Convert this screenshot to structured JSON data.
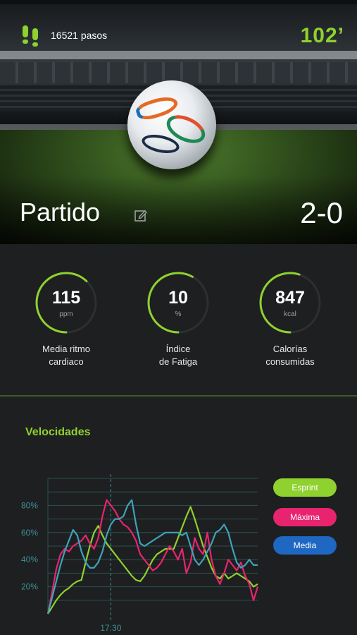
{
  "header": {
    "steps_text": "16521 pasos",
    "minute": "102’",
    "match_title": "Partido",
    "score": "2-0"
  },
  "stats": [
    {
      "value": "115",
      "unit": "ppm",
      "label_line1": "Media ritmo",
      "label_line2": "cardiaco",
      "progress": 0.62
    },
    {
      "value": "10",
      "unit": "%",
      "label_line1": "Índice",
      "label_line2": "de Fatiga",
      "progress": 0.58
    },
    {
      "value": "847",
      "unit": "kcal",
      "label_line1": "Calorías",
      "label_line2": "consumidas",
      "progress": 0.55
    }
  ],
  "colors": {
    "accent": "#8fd12e",
    "esprint": "#8fd12e",
    "maxima": "#e8246e",
    "media": "#1e67c2",
    "background": "#1e1f21"
  },
  "chart_data": {
    "type": "line",
    "title": "Velocidades",
    "xlabel": "",
    "ylabel": "",
    "x_tick_labels": [
      "17:30"
    ],
    "y_tick_labels": [
      "80%",
      "60%",
      "40%",
      "20%"
    ],
    "ylim": [
      0,
      100
    ],
    "x": [
      0,
      1,
      2,
      3,
      4,
      5,
      6,
      7,
      8,
      9,
      10,
      11,
      12,
      13,
      14,
      15,
      16,
      17,
      18,
      19,
      20,
      21,
      22,
      23,
      24,
      25,
      26,
      27,
      28,
      29,
      30,
      31,
      32,
      33,
      34,
      35,
      36,
      37,
      38,
      39,
      40,
      41,
      42,
      43,
      44,
      45,
      46,
      47,
      48,
      49,
      50
    ],
    "series": [
      {
        "name": "Esprint",
        "values": [
          0,
          5,
          10,
          14,
          17,
          19,
          22,
          24,
          25,
          38,
          50,
          60,
          65,
          58,
          52,
          48,
          44,
          40,
          36,
          32,
          28,
          25,
          24,
          28,
          34,
          40,
          44,
          46,
          48,
          48,
          48,
          56,
          64,
          72,
          79,
          70,
          60,
          50,
          42,
          34,
          28,
          26,
          30,
          26,
          28,
          30,
          28,
          26,
          24,
          20,
          22
        ]
      },
      {
        "name": "Máxima",
        "values": [
          0,
          16,
          33,
          44,
          48,
          46,
          50,
          52,
          54,
          58,
          52,
          48,
          56,
          72,
          84,
          80,
          76,
          70,
          66,
          64,
          60,
          54,
          44,
          40,
          36,
          32,
          34,
          38,
          44,
          50,
          46,
          40,
          48,
          30,
          38,
          56,
          48,
          44,
          60,
          40,
          28,
          22,
          30,
          40,
          36,
          32,
          38,
          28,
          22,
          10,
          20
        ]
      },
      {
        "name": "Media",
        "values": [
          0,
          12,
          24,
          36,
          46,
          54,
          62,
          58,
          46,
          38,
          34,
          34,
          38,
          46,
          58,
          66,
          70,
          70,
          72,
          80,
          84,
          66,
          52,
          50,
          52,
          54,
          56,
          58,
          60,
          60,
          60,
          60,
          58,
          60,
          50,
          40,
          36,
          40,
          46,
          52,
          60,
          62,
          66,
          60,
          48,
          38,
          34,
          36,
          40,
          36,
          36
        ]
      }
    ],
    "marker_x": 15,
    "grid": true,
    "legend_position": "right"
  }
}
